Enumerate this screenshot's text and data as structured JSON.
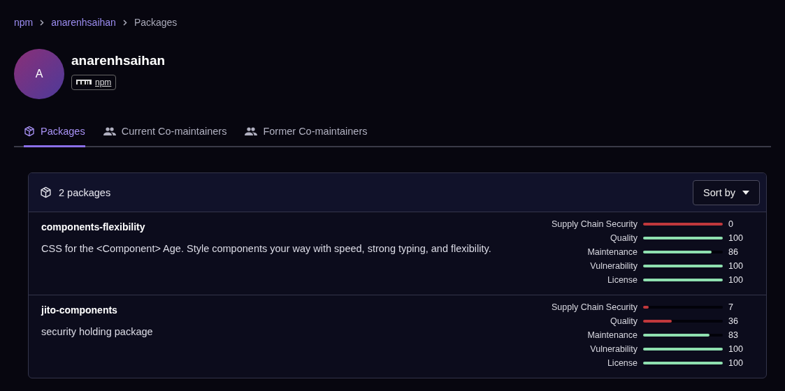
{
  "breadcrumb": [
    {
      "label": "npm",
      "kind": "link"
    },
    {
      "label": "anarenhsaihan",
      "kind": "link"
    },
    {
      "label": "Packages",
      "kind": "current"
    }
  ],
  "profile": {
    "avatar_letter": "A",
    "name": "anarenhsaihan",
    "registry_badge": "npm"
  },
  "tabs": [
    {
      "label": "Packages",
      "selected": true,
      "kind": "package"
    },
    {
      "label": "Current Co-maintainers",
      "selected": false,
      "kind": "people"
    },
    {
      "label": "Former Co-maintainers",
      "selected": false,
      "kind": "people"
    }
  ],
  "packages_panel": {
    "count": "2 packages",
    "sort_button": "Sort by",
    "packages": [
      {
        "name": "components-flexibility",
        "description": "CSS for the <Component> Age. Style components your way with speed, strong typing, and flexibility.",
        "scores": [
          {
            "label": "Supply Chain Security",
            "value": "0",
            "level": 1,
            "color": "#c0383c"
          },
          {
            "label": "Quality",
            "value": "100",
            "level": 1,
            "color": "#8fe0b0"
          },
          {
            "label": "Maintenance",
            "value": "86",
            "level": 0.86,
            "color": "#8fe0b0"
          },
          {
            "label": "Vulnerability",
            "value": "100",
            "level": 1,
            "color": "#8fe0b0"
          },
          {
            "label": "License",
            "value": "100",
            "level": 1,
            "color": "#8fe0b0"
          }
        ]
      },
      {
        "name": "jito-components",
        "description": "security holding package",
        "scores": [
          {
            "label": "Supply Chain Security",
            "value": "7",
            "level": 0.07,
            "color": "#c0383c"
          },
          {
            "label": "Quality",
            "value": "36",
            "level": 0.36,
            "color": "#c0383c"
          },
          {
            "label": "Maintenance",
            "value": "83",
            "level": 0.83,
            "color": "#8fe0b0"
          },
          {
            "label": "Vulnerability",
            "value": "100",
            "level": 1,
            "color": "#8fe0b0"
          },
          {
            "label": "License",
            "value": "100",
            "level": 1,
            "color": "#8fe0b0"
          }
        ]
      }
    ]
  }
}
